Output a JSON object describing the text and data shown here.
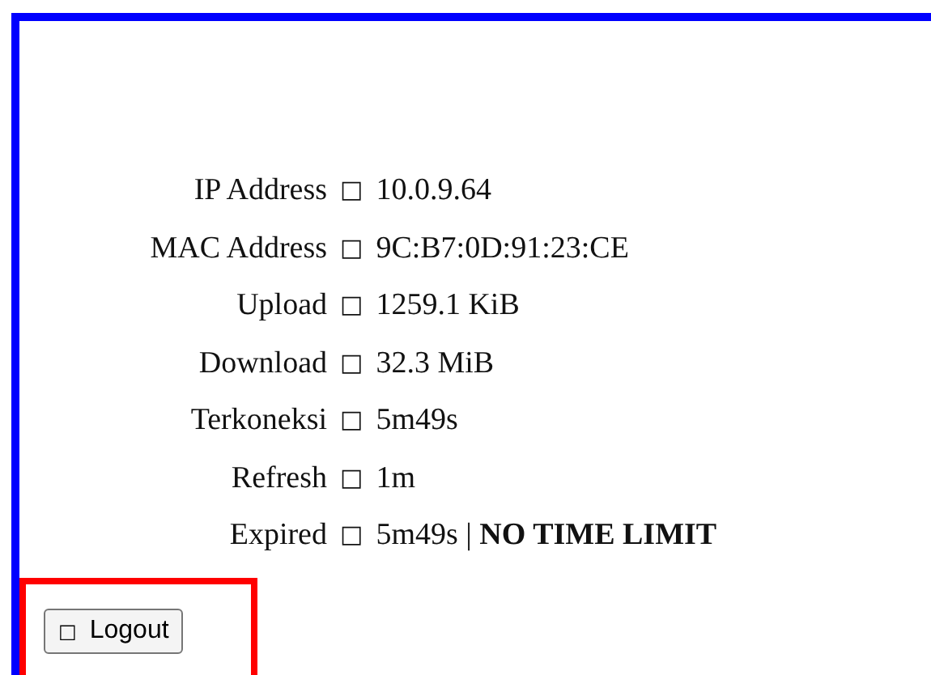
{
  "rows": [
    {
      "label": "IP Address",
      "sep": "□",
      "value": "10.0.9.64"
    },
    {
      "label": "MAC Address",
      "sep": "□",
      "value": "9C:B7:0D:91:23:CE"
    },
    {
      "label": "Upload",
      "sep": "□",
      "value": "1259.1 KiB"
    },
    {
      "label": "Download",
      "sep": "□",
      "value": "32.3 MiB"
    },
    {
      "label": "Terkoneksi",
      "sep": "□",
      "value": "5m49s"
    },
    {
      "label": "Refresh",
      "sep": "□",
      "value": "1m"
    },
    {
      "label": "Expired",
      "sep": "□",
      "value": "5m49s | **NO TIME LIMIT**"
    }
  ],
  "logout_button": {
    "icon": "□",
    "label": "Logout"
  }
}
